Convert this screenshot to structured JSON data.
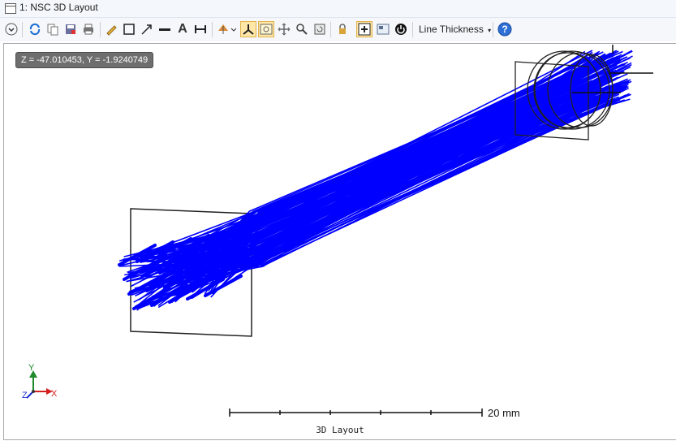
{
  "window": {
    "title": "1: NSC 3D Layout"
  },
  "toolbar": {
    "line_thickness_label": "Line Thickness"
  },
  "viewport": {
    "coordinate_readout": "Z = -47.010453, Y = -1.9240749",
    "scale_bar_label": "20 mm",
    "axis_labels": {
      "x": "X",
      "y": "Y",
      "z": "Z"
    },
    "ray_color": "#0000ff"
  },
  "footer": {
    "label": "3D Layout"
  }
}
